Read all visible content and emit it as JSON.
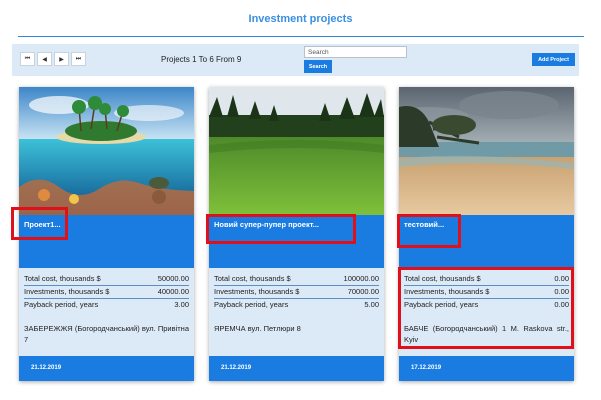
{
  "page": {
    "title": "Investment projects"
  },
  "toolbar": {
    "pager_buttons": [
      {
        "name": "first-page",
        "glyph": "⏮"
      },
      {
        "name": "prev-page",
        "glyph": "◀"
      },
      {
        "name": "next-page",
        "glyph": "▶"
      },
      {
        "name": "last-page",
        "glyph": "⏭"
      }
    ],
    "status": "Projects 1 To 6 From 9",
    "search_placeholder": "Search",
    "search_label": "Search",
    "add_label": "Add Project"
  },
  "labels": {
    "total_cost": "Total cost, thousands $",
    "investments": "Investments, thousands $",
    "payback": "Payback period, years"
  },
  "projects": [
    {
      "title": "Проект1...",
      "total_cost": "50000.00",
      "investments": "40000.00",
      "payback": "3.00",
      "address": "ЗАБЕРЕЖЖЯ (Богородчанський) вул. Привітна 7",
      "date": "21.12.2019",
      "image": "tropical-island-icon"
    },
    {
      "title": "Новий супер-пупер проект...",
      "total_cost": "100000.00",
      "investments": "70000.00",
      "payback": "5.00",
      "address": "ЯРЕМЧА вул. Петлюри 8",
      "date": "21.12.2019",
      "image": "golf-field-icon"
    },
    {
      "title": "тестовий...",
      "total_cost": "0.00",
      "investments": "0.00",
      "payback": "0.00",
      "address": "БАБЧЕ (Богородчанський) 1 M. Raskova str., Kyiv",
      "date": "17.12.2019",
      "image": "beach-icon"
    }
  ],
  "colors": {
    "accent": "#1a7ce0",
    "panel": "#dce9f7",
    "highlight": "#e0101a"
  }
}
